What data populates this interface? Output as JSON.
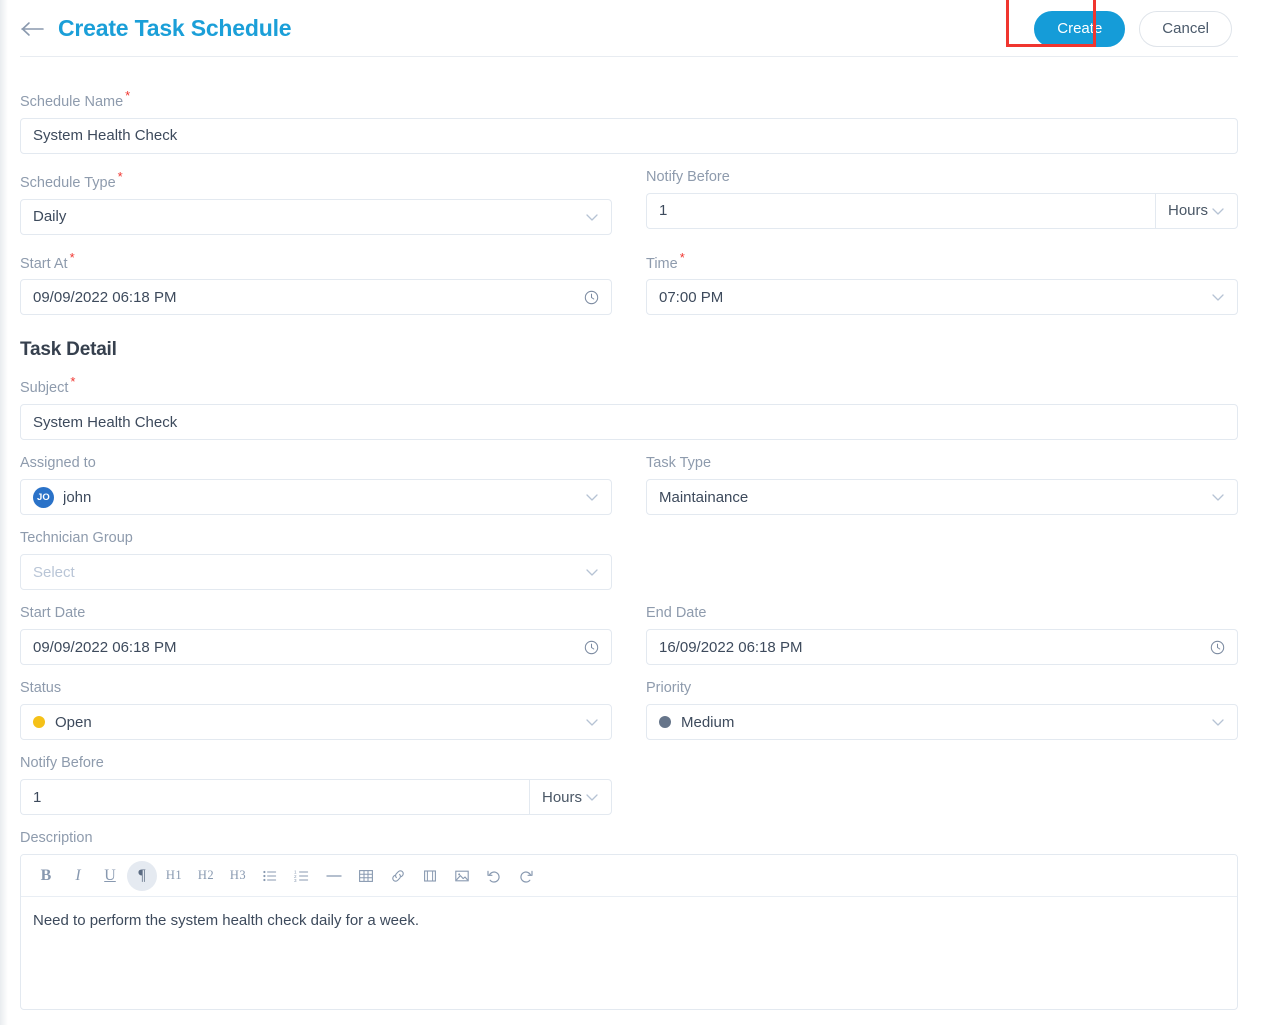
{
  "header": {
    "back_icon": "arrow-left-icon",
    "title": "Create Task Schedule",
    "create_label": "Create",
    "cancel_label": "Cancel",
    "create_button_color": "#159cd8",
    "highlight_color": "#f0352f"
  },
  "schedule": {
    "name": {
      "label": "Schedule Name",
      "required": "*",
      "value": "System Health Check"
    },
    "type": {
      "label": "Schedule Type",
      "required": "*",
      "value": "Daily"
    },
    "notify_before": {
      "label": "Notify Before",
      "value": "1",
      "unit": "Hours"
    },
    "start_at": {
      "label": "Start At",
      "required": "*",
      "value": "09/09/2022 06:18 PM",
      "icon": "clock-icon"
    },
    "time": {
      "label": "Time",
      "required": "*",
      "value": "07:00 PM"
    }
  },
  "task_detail": {
    "section_title": "Task Detail",
    "subject": {
      "label": "Subject",
      "required": "*",
      "value": "System Health Check"
    },
    "assigned_to": {
      "label": "Assigned to",
      "avatar_initials": "JO",
      "avatar_color": "#2a72c8",
      "value": "john"
    },
    "task_type": {
      "label": "Task Type",
      "value": "Maintainance"
    },
    "technician_group": {
      "label": "Technician Group",
      "placeholder": "Select"
    },
    "start_date": {
      "label": "Start Date",
      "value": "09/09/2022 06:18 PM",
      "icon": "clock-icon"
    },
    "end_date": {
      "label": "End Date",
      "value": "16/09/2022 06:18 PM",
      "icon": "clock-icon"
    },
    "status": {
      "label": "Status",
      "value": "Open",
      "dot_color": "#f5c118"
    },
    "priority": {
      "label": "Priority",
      "value": "Medium",
      "dot_color": "#66758a"
    },
    "notify_before": {
      "label": "Notify Before",
      "value": "1",
      "unit": "Hours"
    },
    "description": {
      "label": "Description",
      "value": "Need to perform the system health check daily for a week.",
      "toolbar": [
        {
          "name": "bold-icon",
          "glyph": "B",
          "active": false
        },
        {
          "name": "italic-icon",
          "glyph": "I",
          "active": false
        },
        {
          "name": "underline-icon",
          "glyph": "U",
          "active": false
        },
        {
          "name": "paragraph-icon",
          "glyph": "¶",
          "active": true
        },
        {
          "name": "heading-1-icon",
          "glyph": "H1",
          "active": false
        },
        {
          "name": "heading-2-icon",
          "glyph": "H2",
          "active": false
        },
        {
          "name": "heading-3-icon",
          "glyph": "H3",
          "active": false
        },
        {
          "name": "bullet-list-icon",
          "glyph": "",
          "active": false
        },
        {
          "name": "ordered-list-icon",
          "glyph": "",
          "active": false
        },
        {
          "name": "horizontal-rule-icon",
          "glyph": "",
          "active": false
        },
        {
          "name": "table-icon",
          "glyph": "",
          "active": false
        },
        {
          "name": "link-icon",
          "glyph": "",
          "active": false
        },
        {
          "name": "video-icon",
          "glyph": "",
          "active": false
        },
        {
          "name": "image-icon",
          "glyph": "",
          "active": false
        },
        {
          "name": "undo-icon",
          "glyph": "",
          "active": false
        },
        {
          "name": "redo-icon",
          "glyph": "",
          "active": false
        }
      ]
    }
  }
}
